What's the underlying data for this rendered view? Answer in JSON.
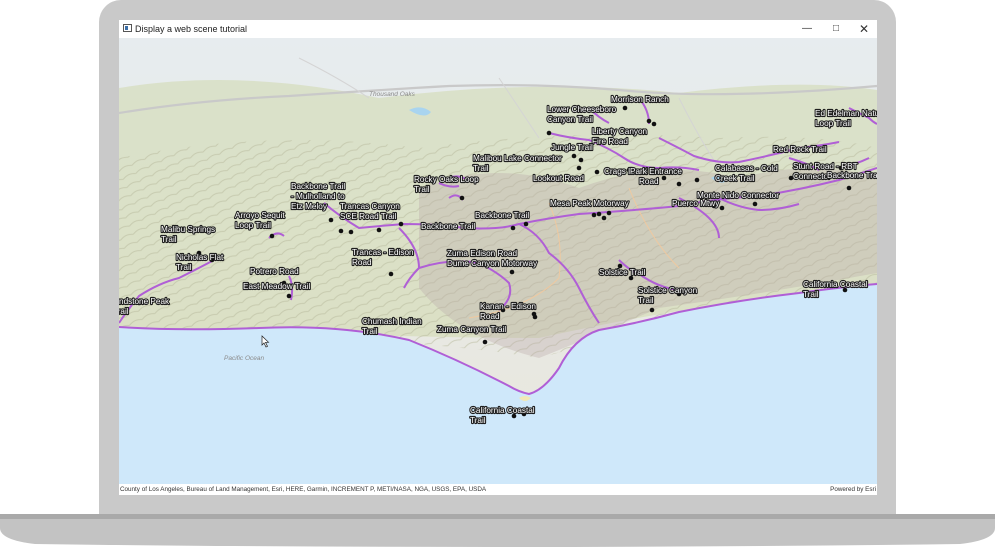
{
  "window": {
    "title": "Display a web scene tutorial",
    "minimize_icon": "minimize-icon",
    "maximize_icon": "maximize-icon",
    "close_icon": "close-icon"
  },
  "map": {
    "basemap_labels": {
      "thousand_oaks": "Thousand Oaks",
      "pacific_ocean": "Pacific Ocean"
    },
    "trail_color": "#b05fd6",
    "trailhead_color": "#111111",
    "trail_labels": [
      "Morrison Ranch",
      "Lower Cheeseboro",
      "Canyon Trail",
      "Liberty Canyon",
      "Fire Road",
      "Ed Edelman Nature",
      "Loop Trail",
      "Red Rock Trail",
      "Jungle Trail",
      "Malibou Lake Connector",
      "Trail",
      "Calabasas - Cold",
      "Creek Trail",
      "Stunt Road - RBT",
      "Connector",
      "Backbone Trail",
      "Crags Road",
      "Park Entrance",
      "Road",
      "Lookout Road",
      "Rocky Oaks Loop",
      "Trail",
      "Monte Nido Connector",
      "Backbone Trail",
      "- Mulholland to",
      "Etz Meloy",
      "Trancas Canyon",
      "SCE Road Trail",
      "Mesa Peak Motorway",
      "Puerco Mtwy",
      "Arroyo Sequit",
      "Loop Trail",
      "Backbone Trail",
      "Backbone Trail",
      "Malibu Springs",
      "Trail",
      "Nicholas Flat",
      "Trail",
      "Trancas - Edison",
      "Road",
      "Zuma Edison Road",
      "Dume Canyon Motorway",
      "Potrero Road",
      "East Meadow Trail",
      "Solstice Trail",
      "Solstice Canyon",
      "Trail",
      "California Coastal",
      "Trail",
      "Sandstone Peak",
      "Trail",
      "Chumash Indian",
      "Trail",
      "Kanan - Edison",
      "Road",
      "Zuma Canyon Trail",
      "California Coastal",
      "Trail",
      "Trail"
    ]
  },
  "attribution": {
    "sources": "County of Los Angeles, Bureau of Land Management, Esri, HERE, Garmin, INCREMENT P, METI/NASA, NGA, USGS, EPA, USDA",
    "powered_by": "Powered by Esri"
  },
  "colors": {
    "water": "#cfe8fa",
    "land": "#e9e6d9",
    "vegetation": "#c7d4a6",
    "frame": "#c9c9c9"
  }
}
